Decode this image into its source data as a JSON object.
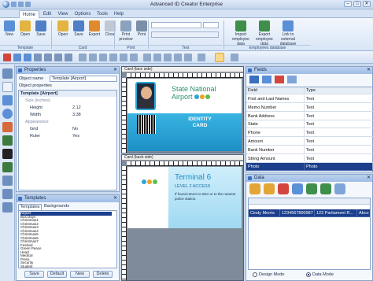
{
  "title_bar": {
    "title": "Advanced ID Creator Enterprise",
    "buttons": [
      "–",
      "□",
      "✕"
    ]
  },
  "menu": {
    "tabs": [
      "Home",
      "Edit",
      "View",
      "Options",
      "Tools",
      "Help"
    ],
    "active": "Home"
  },
  "ribbon": {
    "buttons": [
      {
        "label": "New",
        "color": "#5b8fd6"
      },
      {
        "label": "Open",
        "color": "#e3b440"
      },
      {
        "label": "Save",
        "color": "#4e7fc6"
      },
      {
        "label": "Open",
        "color": "#e3b440"
      },
      {
        "label": "Save",
        "color": "#4e7fc6"
      },
      {
        "label": "Export",
        "color": "#e08a2e"
      },
      {
        "label": "Close",
        "color": "#c0c8d4"
      },
      {
        "label": "Print preview",
        "color": "#8aa2c0"
      },
      {
        "label": "Print",
        "color": "#7b8ea8"
      },
      {
        "label": "Import employee data",
        "color": "#3f8f4a"
      },
      {
        "label": "Export employee data",
        "color": "#3f8f4a"
      },
      {
        "label": "Link to external database",
        "color": "#5b8fd6"
      }
    ],
    "groups": [
      "Template",
      "Card",
      "Print",
      "Text",
      "Employees database"
    ]
  },
  "properties": {
    "header": "Properties",
    "object_name_label": "Object name",
    "object_name_value": "Template [Airport]",
    "object_properties_label": "Object properties",
    "rows": [
      {
        "name": "Template [Airport]",
        "value": "",
        "type": "category"
      },
      {
        "name": "Size (inches)",
        "value": "",
        "type": "subcategory"
      },
      {
        "name": "Height",
        "value": "2.12",
        "type": "prop"
      },
      {
        "name": "Width",
        "value": "3.38",
        "type": "prop"
      },
      {
        "name": "Appearance",
        "value": "",
        "type": "subcategory"
      },
      {
        "name": "Grid",
        "value": "No",
        "type": "prop"
      },
      {
        "name": "Ruler",
        "value": "Yes",
        "type": "prop"
      }
    ]
  },
  "templates": {
    "header": "Templates",
    "tabs": [
      "Templates",
      "Backgrounds"
    ],
    "items": [
      "Airport",
      "Bus Days",
      "Christmas1",
      "Christmas2",
      "Christmas3",
      "Christmas4",
      "Christmas5",
      "Christmas6",
      "Christmas7",
      "Festival",
      "Green Peace",
      "Heart",
      "Medical",
      "Press",
      "Security",
      "Student"
    ],
    "selected": "Airport",
    "buttons": [
      "Save",
      "Default",
      "New",
      "Delete"
    ]
  },
  "card_front": {
    "header": "Card (face side)",
    "title_line1": "State National",
    "title_line2": "Airport",
    "badge_line1": "IDENTITY",
    "badge_line2": "CARD",
    "accent": "#2aa7d8",
    "dot_colors": [
      "#2aa7d8",
      "#f0a020",
      "#5bbf4a"
    ]
  },
  "card_back": {
    "header": "Card (back side)",
    "title": "Terminal 6",
    "subtitle": "LEVEL 2 ACCESS",
    "notice": "If found return to SNA or to the nearest police station.",
    "dot_colors": [
      "#2aa7d8",
      "#f0a020",
      "#5bbf4a"
    ]
  },
  "fields": {
    "header": "Fields",
    "columns": [
      "Field",
      "Type"
    ],
    "rows": [
      {
        "field": "First and Last Names",
        "type": "Text"
      },
      {
        "field": "Memo Number",
        "type": "Text"
      },
      {
        "field": "Bank Address",
        "type": "Text"
      },
      {
        "field": "State",
        "type": "Text"
      },
      {
        "field": "Phone",
        "type": "Text"
      },
      {
        "field": "Amount",
        "type": "Text"
      },
      {
        "field": "Bank Number",
        "type": "Text"
      },
      {
        "field": "String Amount",
        "type": "Text"
      },
      {
        "field": "Photo",
        "type": "Photo"
      }
    ],
    "selected_index": 8
  },
  "data": {
    "header": "Data",
    "row": {
      "name": "Cindy Morris",
      "number": "1234567890987",
      "address": "123 Parliament R...",
      "extra": "Abco"
    },
    "modes": [
      "Design Mode",
      "Data Mode"
    ],
    "mode_selected": "Data Mode"
  }
}
